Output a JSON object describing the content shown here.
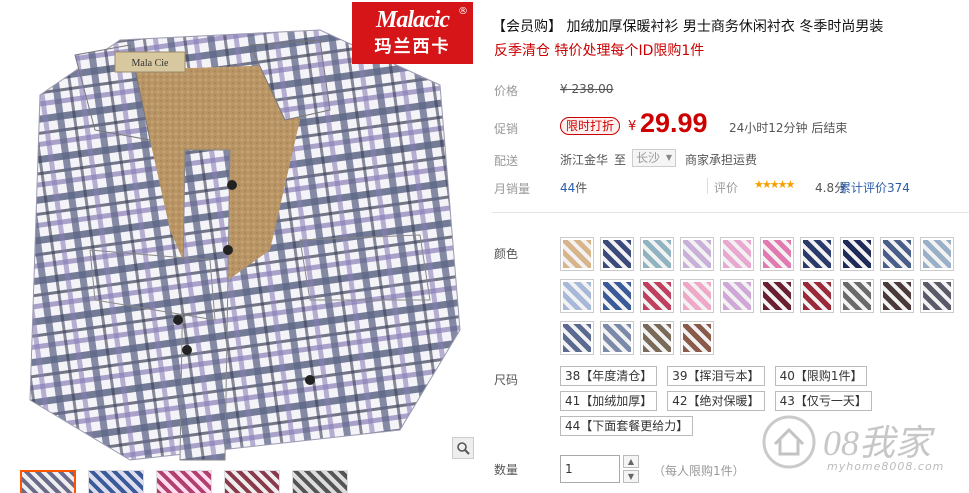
{
  "brand": {
    "logo_en": "Malacic",
    "logo_zh": "玛兰西卡",
    "reg_mark": "®",
    "collar_label": "Mala Cie"
  },
  "product": {
    "title": "【会员购】 加绒加厚保暖衬衫 男士商务休闲衬衣 冬季时尚男装",
    "subtitle": "反季清仓 特价处理每个ID限购1件"
  },
  "price": {
    "label": "价格",
    "original": "¥ 238.00",
    "promo_label": "促销",
    "promo_badge": "限时打折",
    "currency": "¥",
    "current": "29.99",
    "countdown": "24小时12分钟 后结束"
  },
  "shipping": {
    "label": "配送",
    "from": "浙江金华",
    "to_label": "至",
    "destination": "长沙",
    "note": "商家承担运费"
  },
  "sales": {
    "label": "月销量",
    "count": "44",
    "unit": "件"
  },
  "rating": {
    "label": "评价",
    "stars": "★★★★★",
    "score": "4.8分",
    "link": "累计评价374"
  },
  "colors": {
    "label": "颜色",
    "swatches": [
      {
        "name": "color-1",
        "color": "#d8b48a"
      },
      {
        "name": "color-2",
        "color": "#3a4a7a"
      },
      {
        "name": "color-3",
        "color": "#8fb4c0"
      },
      {
        "name": "color-4",
        "color": "#c8b0d8"
      },
      {
        "name": "color-5",
        "color": "#e8a8d0"
      },
      {
        "name": "color-6",
        "color": "#e07ab0"
      },
      {
        "name": "color-7",
        "color": "#2a3a6a"
      },
      {
        "name": "color-8",
        "color": "#1e2a58"
      },
      {
        "name": "color-9",
        "color": "#4a5e8a"
      },
      {
        "name": "color-10",
        "color": "#9ab0c8"
      },
      {
        "name": "color-11",
        "color": "#a8b8d8"
      },
      {
        "name": "color-12",
        "color": "#3a5a9a"
      },
      {
        "name": "color-13",
        "color": "#c04060"
      },
      {
        "name": "color-14",
        "color": "#f0a8c8"
      },
      {
        "name": "color-15",
        "color": "#d0a8d8"
      },
      {
        "name": "color-16",
        "color": "#6a2030"
      },
      {
        "name": "color-17",
        "color": "#9a2a3a"
      },
      {
        "name": "color-18",
        "color": "#6a6a6a"
      },
      {
        "name": "color-19",
        "color": "#4a3a3a"
      },
      {
        "name": "color-20",
        "color": "#5a5a68"
      },
      {
        "name": "color-21",
        "color": "#5a6a90"
      },
      {
        "name": "color-22",
        "color": "#7a8aa8"
      },
      {
        "name": "color-23",
        "color": "#7a6a5a"
      },
      {
        "name": "color-24",
        "color": "#8a5a4a"
      }
    ]
  },
  "sizes": {
    "label": "尺码",
    "options": [
      "38【年度清仓】",
      "39【挥泪亏本】",
      "40【限购1件】",
      "41【加绒加厚】",
      "42【绝对保暖】",
      "43【仅亏一天】",
      "44【下面套餐更给力】"
    ]
  },
  "quantity": {
    "label": "数量",
    "value": "1",
    "note": "（每人限购1件）"
  },
  "watermark": {
    "text": "08我家",
    "url": "myhome8008.com"
  },
  "accent": "#cc0000"
}
